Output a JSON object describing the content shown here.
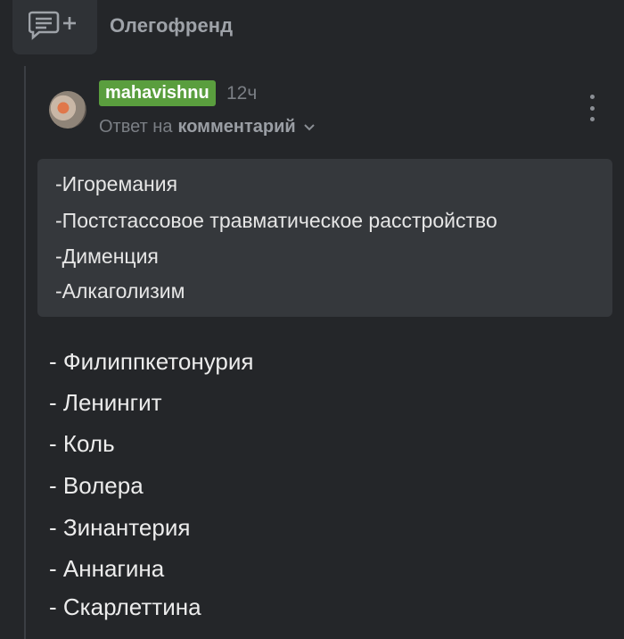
{
  "header": {
    "title": "Олегофренд"
  },
  "comment": {
    "username": "mahavishnu",
    "time": "12ч",
    "reply_prefix": "Ответ на",
    "reply_target": "комментарий",
    "quote": [
      "-Игоремания",
      "-Постстассовое травматическое расстройство",
      "-Дименция",
      "-Алкаголизим"
    ],
    "body": [
      "- Филиппкетонурия",
      "- Ленингит",
      "- Коль",
      "- Волера",
      "- Зинантерия",
      "- Аннагина",
      "- Скарлеттина"
    ]
  },
  "colors": {
    "background": "#242629",
    "username_badge": "#5a9e3e",
    "quote_background": "#35383c"
  },
  "icons": {
    "reply_thread": "comment-add-icon",
    "reply_dropdown": "chevron-down-icon",
    "more": "more-vertical-icon"
  }
}
